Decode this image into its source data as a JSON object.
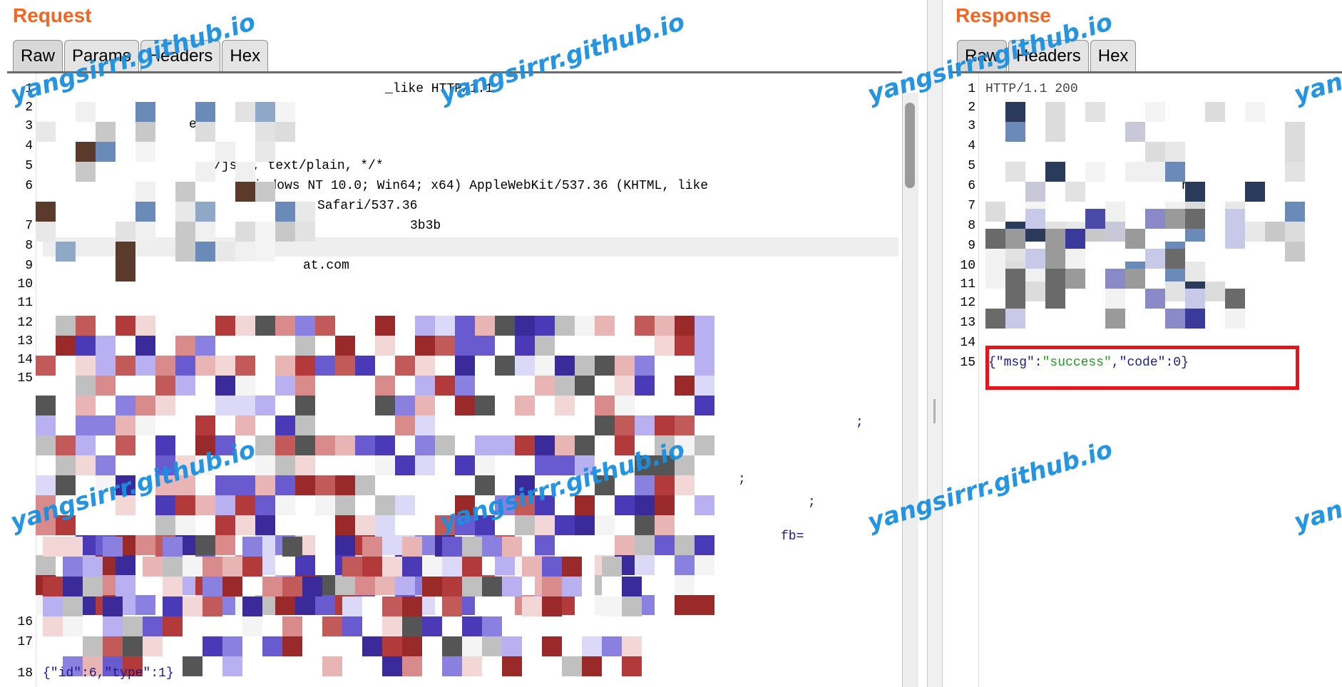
{
  "request": {
    "title": "Request",
    "tabs": [
      "Raw",
      "Params",
      "Headers",
      "Hex"
    ],
    "active_tab": "Raw",
    "line_numbers": [
      "1",
      "2",
      "3",
      "4",
      "5",
      "6",
      "7",
      "8",
      "9",
      "10",
      "11",
      "12",
      "13",
      "14",
      "15",
      "16",
      "17",
      "18"
    ],
    "visible_fragments": {
      "line1": "_like HTTP/1.1",
      "line3": "e",
      "line5": "/json, text/plain, */*",
      "line6": "Windows NT 10.0; Win64; x64) AppleWebKit/537.36 (KHTML, like",
      "line6b": "Safari/537.36",
      "line7": "3b3b",
      "line9": "at.com",
      "line15a": ";",
      "line15b": ";",
      "line15c": ";",
      "line15d": "fb="
    },
    "body_parts": [
      "{\"id\":",
      "6",
      ",\"type\":",
      "1",
      "}"
    ]
  },
  "response": {
    "title": "Response",
    "tabs": [
      "Raw",
      "Headers",
      "Hex"
    ],
    "active_tab": "Raw",
    "line_numbers": [
      "1",
      "2",
      "3",
      "4",
      "5",
      "6",
      "7",
      "8",
      "9",
      "10",
      "11",
      "12",
      "13",
      "14",
      "15"
    ],
    "visible_fragments": {
      "line1": "HTTP/1.1 200",
      "line6": "ng",
      "line13": "con"
    },
    "body_parts": [
      "{\"msg\":",
      "\"success\"",
      ",\"code\":",
      "0",
      "}"
    ],
    "highlight_color": "#e8141b"
  },
  "watermark": "yangsirrr.github.io",
  "colors": {
    "title_orange": "#f26522",
    "watermark_blue": "#1a8fe0",
    "json_key": "#1a1a8a",
    "json_string": "#1e9a1e"
  }
}
